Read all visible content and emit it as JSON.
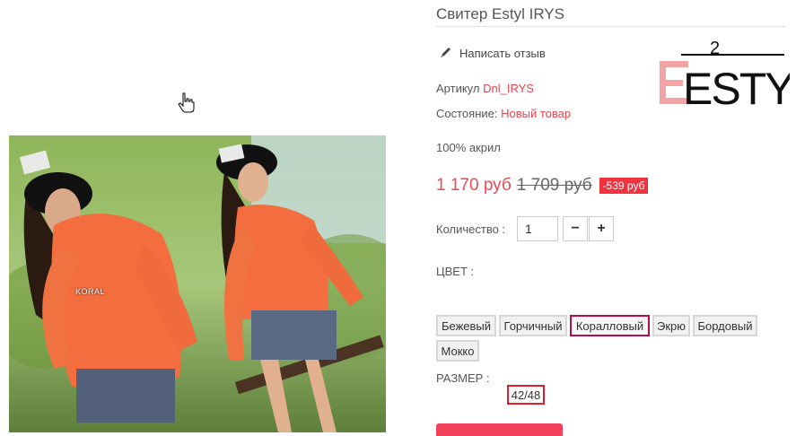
{
  "product": {
    "title": "Свитер Estyl IRYS",
    "review_link": "Написать отзыв",
    "article_label": "Артикул",
    "article_value": "Dnl_IRYS",
    "condition_label": "Состояние:",
    "condition_value": "Новый товар",
    "composition": "100% акрил"
  },
  "brand": {
    "logo_text": "ESTYL",
    "logo_superscript": "2"
  },
  "pricing": {
    "current": "1 170 руб",
    "old": "1 709 руб",
    "discount": "-539 руб"
  },
  "quantity": {
    "label": "Количество :",
    "value": "1",
    "minus": "−",
    "plus": "+"
  },
  "colors": {
    "label": "ЦВЕТ :",
    "options": [
      "Бежевый",
      "Горчичный",
      "Коралловый",
      "Экрю",
      "Бордовый",
      "Мокко"
    ],
    "selected": "Коралловый"
  },
  "sizes": {
    "label": "РАЗМЕР :",
    "options": [
      "42/48"
    ],
    "selected": "42/48"
  },
  "image": {
    "watermark": "KORAL"
  },
  "theme": {
    "accent": "#e3474f",
    "price": "#ea4a53",
    "badge": "#f13340",
    "selected_border": "#b30e4a",
    "size_border": "#e01f2b",
    "cart": "#f2415a"
  },
  "icons": {
    "review": "pencil-icon",
    "cursor": "hand-cursor-icon"
  }
}
